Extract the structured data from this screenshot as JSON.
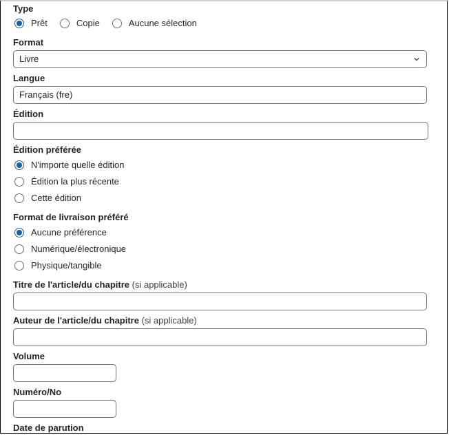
{
  "type": {
    "label": "Type",
    "options": [
      {
        "label": "Prêt",
        "checked": true
      },
      {
        "label": "Copie",
        "checked": false
      },
      {
        "label": "Aucune sélection",
        "checked": false
      }
    ]
  },
  "format": {
    "label": "Format",
    "value": "Livre",
    "icon": "chevron-down-icon"
  },
  "langue": {
    "label": "Langue",
    "value": "Français (fre)"
  },
  "edition": {
    "label": "Édition",
    "value": ""
  },
  "edition_preferee": {
    "label": "Édition préférée",
    "options": [
      {
        "label": "N'importe quelle édition",
        "checked": true
      },
      {
        "label": "Édition la plus récente",
        "checked": false
      },
      {
        "label": "Cette édition",
        "checked": false
      }
    ]
  },
  "format_livraison": {
    "label": "Format de livraison préféré",
    "options": [
      {
        "label": "Aucune préférence",
        "checked": true
      },
      {
        "label": "Numérique/électronique",
        "checked": false
      },
      {
        "label": "Physique/tangible",
        "checked": false
      }
    ]
  },
  "titre_article": {
    "label": "Titre de l'article/du chapitre",
    "hint": "(si applicable)",
    "value": ""
  },
  "auteur_article": {
    "label": "Auteur de l'article/du chapitre",
    "hint": "(si applicable)",
    "value": ""
  },
  "volume": {
    "label": "Volume",
    "value": ""
  },
  "numero": {
    "label": "Numéro/No",
    "value": ""
  },
  "date_parution": {
    "label": "Date de parution"
  },
  "colors": {
    "accent": "#1c5fa8",
    "border": "#6e7378"
  }
}
